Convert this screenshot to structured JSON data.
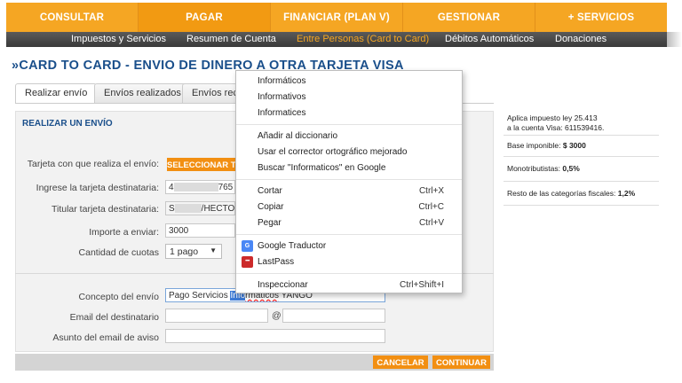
{
  "topnav": [
    "CONSULTAR",
    "PAGAR",
    "FINANCIAR (PLAN V)",
    "GESTIONAR",
    "+ SERVICIOS"
  ],
  "subnav": [
    "Impuestos y Servicios",
    "Resumen de Cuenta",
    "Entre Personas (Card to Card)",
    "Débitos Automáticos",
    "Donaciones"
  ],
  "page_title": "»CARD TO CARD - ENVIO DE DINERO A OTRA TARJETA VISA",
  "tabs": [
    "Realizar envío",
    "Envíos realizados",
    "Envíos reci"
  ],
  "form": {
    "section_title": "REALIZAR UN ENVÍO",
    "card_label": "Tarjeta con que realiza el envío:",
    "select_card_button": "SELECCIONAR T",
    "dest_card_label": "Ingrese la tarjeta destinataria:",
    "dest_card_prefix": "4",
    "dest_card_suffix": "765",
    "holder_label": "Titular tarjeta destinataria:",
    "holder_prefix": "S",
    "holder_suffix": "/HECTOR",
    "amount_label": "Importe a enviar:",
    "amount_value": "3000",
    "installments_label": "Cantidad de cuotas",
    "installments_value": "1 pago",
    "concept_label": "Concepto del envío",
    "concept_before": "Pago Servicios ",
    "concept_selected": "Info",
    "concept_mid": "rmaticos",
    "concept_after": " YANGO",
    "email_label": "Email del destinatario",
    "email_at": "@",
    "subject_label": "Asunto del email de aviso",
    "cancel_button": "CANCELAR",
    "continue_button": "CONTINUAR"
  },
  "info": {
    "tax_line1": "Aplica impuesto ley 25.413",
    "tax_line2": "a la cuenta Visa: 611539416.",
    "base_label": "Base imponible:",
    "base_value": "$ 3000",
    "mono_label": "Monotributistas:",
    "mono_value": "0,5%",
    "rest_label": "Resto de las categorías fiscales:",
    "rest_value": "1,2%"
  },
  "context_menu": {
    "suggestions": [
      "Informáticos",
      "Informativos",
      "Informatices"
    ],
    "add_dictionary": "Añadir al diccionario",
    "spell_checker": "Usar el corrector ortográfico mejorado",
    "search_google": "Buscar \"Informaticos\" en Google",
    "cut": "Cortar",
    "cut_key": "Ctrl+X",
    "copy": "Copiar",
    "copy_key": "Ctrl+C",
    "paste": "Pegar",
    "paste_key": "Ctrl+V",
    "translate": "Google Traductor",
    "lastpass": "LastPass",
    "inspect": "Inspeccionar",
    "inspect_key": "Ctrl+Shift+I",
    "gt_icon": "G",
    "lp_icon": "•••"
  },
  "colors": {
    "accent": "#f5a623",
    "title_blue": "#1a4f8b",
    "button_orange": "#f28f12"
  }
}
